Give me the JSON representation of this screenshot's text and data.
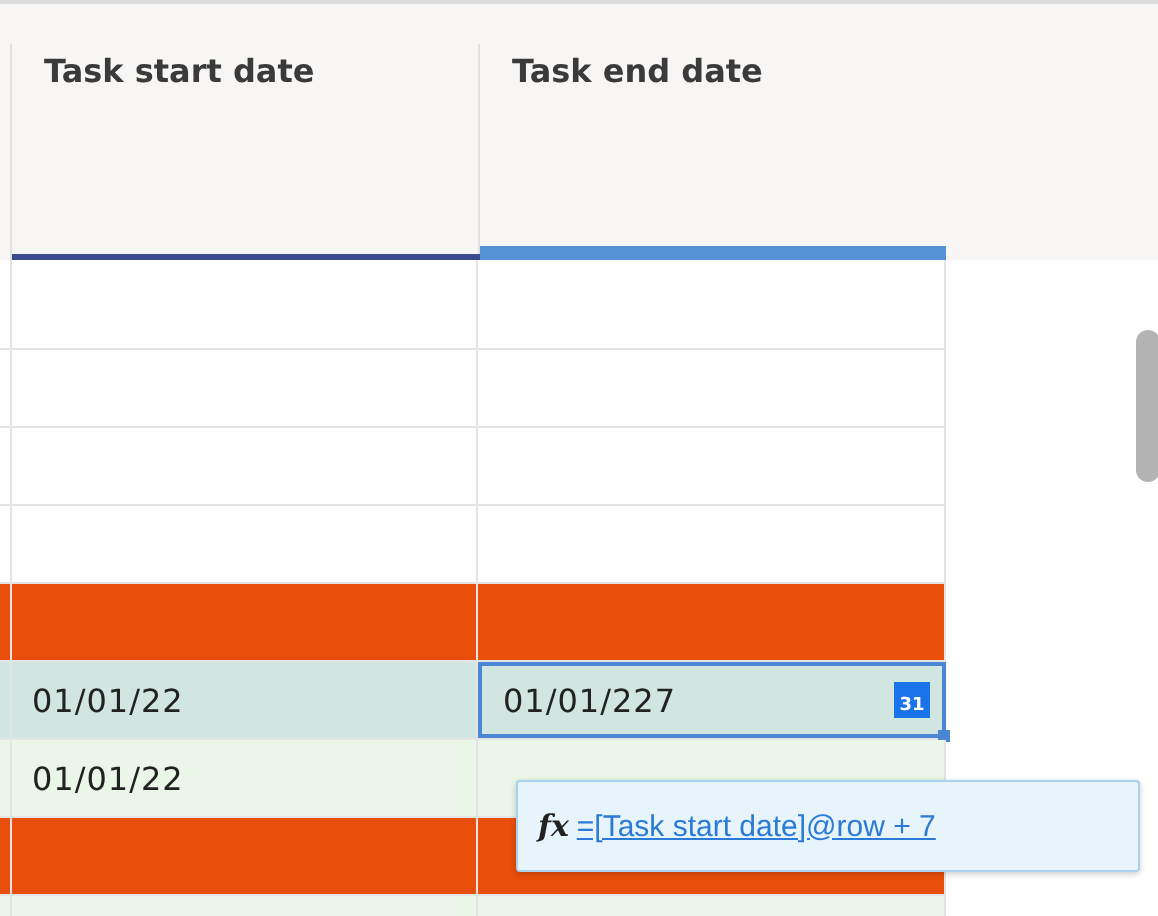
{
  "columns": [
    {
      "label": "Task start date",
      "selected": false
    },
    {
      "label": "Task end date",
      "selected": true
    }
  ],
  "rows": [
    {
      "kind": "blank",
      "cells": [
        null,
        null
      ]
    },
    {
      "kind": "blank",
      "cells": [
        null,
        null
      ]
    },
    {
      "kind": "blank",
      "cells": [
        null,
        null
      ]
    },
    {
      "kind": "blank",
      "cells": [
        null,
        null
      ]
    },
    {
      "kind": "parent",
      "cells": [
        null,
        null
      ]
    },
    {
      "kind": "child",
      "editing": true,
      "cells": [
        "01/01/22",
        "01/01/227"
      ],
      "calendar_day": "31"
    },
    {
      "kind": "child",
      "editing": false,
      "cells": [
        "01/01/22",
        null
      ]
    },
    {
      "kind": "parent",
      "cells": [
        null,
        null
      ]
    },
    {
      "kind": "child",
      "editing": false,
      "cells": [
        null,
        null
      ]
    }
  ],
  "formula_tooltip": {
    "icon_text": "fx",
    "formula": "=[Task start date]@row + 7"
  }
}
